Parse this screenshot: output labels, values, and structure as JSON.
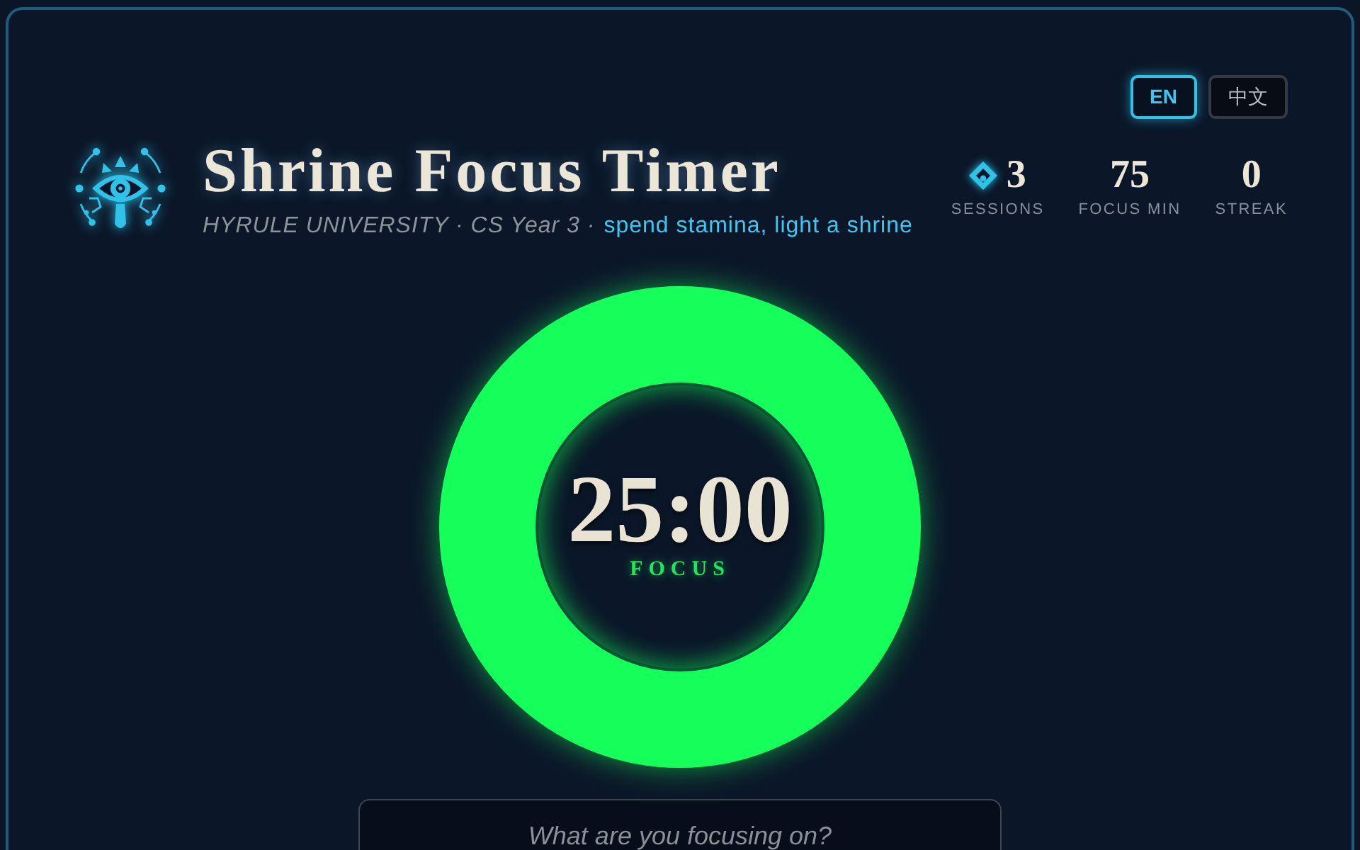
{
  "languages": [
    {
      "label": "EN",
      "selected": true
    },
    {
      "label": "中文",
      "selected": false
    }
  ],
  "header": {
    "title": "Shrine Focus Timer",
    "subtitle": "HYRULE UNIVERSITY · CS Year 3 ·",
    "tagline": "spend stamina, light a shrine"
  },
  "stats": [
    {
      "kind": "marked",
      "value": "3",
      "label": "SESSIONS"
    },
    {
      "kind": "plain",
      "value": "75",
      "label": "FOCUS MIN"
    },
    {
      "kind": "plain",
      "value": "0",
      "label": "STREAK"
    }
  ],
  "timer": {
    "time": "25:00",
    "mode": "FOCUS",
    "level": 1
  },
  "task_field": {
    "placeholder": "What are you focusing on?"
  }
}
